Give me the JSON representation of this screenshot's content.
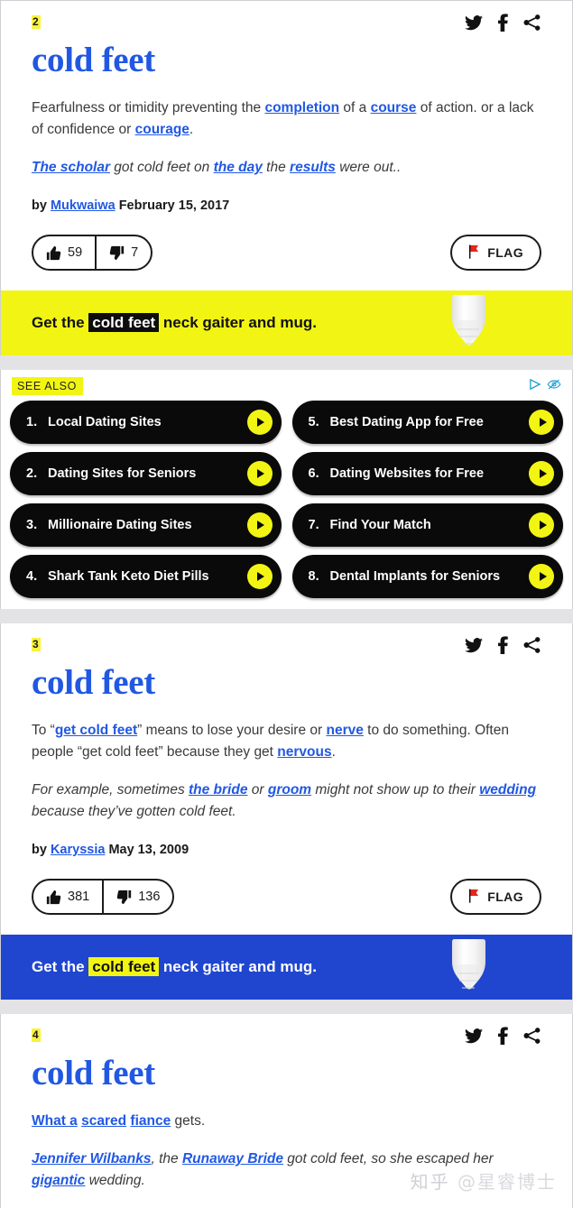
{
  "site": {
    "background_color": "#e3e3e5",
    "card_background": "#ffffff",
    "link_color": "#2158e3",
    "accent_yellow": "#f2f513",
    "accent_blue": "#2046cf"
  },
  "definitions": [
    {
      "number": "2",
      "word": "cold feet",
      "meaning_parts": [
        {
          "text": "Fearfulness or timidity preventing the ",
          "link": false
        },
        {
          "text": "completion",
          "link": true
        },
        {
          "text": " of a ",
          "link": false
        },
        {
          "text": "course",
          "link": true
        },
        {
          "text": " of action. or a lack of confidence or ",
          "link": false
        },
        {
          "text": "courage",
          "link": true
        },
        {
          "text": ".",
          "link": false
        }
      ],
      "example_parts": [
        {
          "text": "The scholar",
          "link": true
        },
        {
          "text": " got cold feet on ",
          "link": false
        },
        {
          "text": "the day",
          "link": true
        },
        {
          "text": " the ",
          "link": false
        },
        {
          "text": "results",
          "link": true
        },
        {
          "text": " were out..",
          "link": false
        }
      ],
      "by_label": "by ",
      "author": "Mukwaiwa",
      "date": " February 15, 2017",
      "upvotes": "59",
      "downvotes": "7",
      "flag_label": "FLAG",
      "merch": {
        "style": "yellow",
        "prefix": "Get the ",
        "highlight": "cold feet",
        "suffix": " neck gaiter and mug."
      }
    },
    {
      "number": "3",
      "word": "cold feet",
      "meaning_parts": [
        {
          "text": "To “",
          "link": false
        },
        {
          "text": "get cold feet",
          "link": true
        },
        {
          "text": "” means to lose your desire or ",
          "link": false
        },
        {
          "text": "nerve",
          "link": true
        },
        {
          "text": " to do something. Often people “get cold feet” because they get ",
          "link": false
        },
        {
          "text": "nervous",
          "link": true
        },
        {
          "text": ".",
          "link": false
        }
      ],
      "example_parts": [
        {
          "text": "For example, sometimes ",
          "link": false
        },
        {
          "text": "the bride",
          "link": true
        },
        {
          "text": " or ",
          "link": false
        },
        {
          "text": "groom",
          "link": true
        },
        {
          "text": " might not show up to their ",
          "link": false
        },
        {
          "text": "wedding",
          "link": true
        },
        {
          "text": " because they’ve gotten cold feet.",
          "link": false
        }
      ],
      "by_label": "by ",
      "author": "Karyssia",
      "date": " May 13, 2009",
      "upvotes": "381",
      "downvotes": "136",
      "flag_label": "FLAG",
      "merch": {
        "style": "blue",
        "prefix": "Get the ",
        "highlight": "cold feet",
        "suffix": " neck gaiter and mug."
      }
    },
    {
      "number": "4",
      "word": "cold feet",
      "meaning_parts": [
        {
          "text": "What a",
          "link": true
        },
        {
          "text": " ",
          "link": false
        },
        {
          "text": "scared",
          "link": true
        },
        {
          "text": " ",
          "link": false
        },
        {
          "text": "fiance",
          "link": true
        },
        {
          "text": " gets.",
          "link": false
        }
      ],
      "example_parts": [
        {
          "text": "Jennifer Wilbanks",
          "link": true
        },
        {
          "text": ", the ",
          "link": false
        },
        {
          "text": "Runaway Bride",
          "link": true
        },
        {
          "text": " got cold feet, so she escaped her ",
          "link": false
        },
        {
          "text": "gigantic",
          "link": true
        },
        {
          "text": " wedding.",
          "link": false
        }
      ]
    }
  ],
  "social_icons": [
    {
      "name": "twitter-icon",
      "label": "Twitter"
    },
    {
      "name": "facebook-icon",
      "label": "Facebook"
    },
    {
      "name": "share-icon",
      "label": "Share"
    }
  ],
  "ad_unit": {
    "see_also_label": "SEE ALSO",
    "adchoices_icons": [
      "adchoices-triangle-icon",
      "hide-ad-eye-icon"
    ],
    "items": [
      {
        "num": "1.",
        "label": "Local Dating Sites"
      },
      {
        "num": "5.",
        "label": "Best Dating App for Free"
      },
      {
        "num": "2.",
        "label": "Dating Sites for Seniors"
      },
      {
        "num": "6.",
        "label": "Dating Websites for Free"
      },
      {
        "num": "3.",
        "label": "Millionaire Dating Sites"
      },
      {
        "num": "7.",
        "label": "Find Your Match"
      },
      {
        "num": "4.",
        "label": "Shark Tank Keto Diet Pills"
      },
      {
        "num": "8.",
        "label": "Dental Implants for Seniors"
      }
    ]
  },
  "watermark": {
    "logo": "知乎",
    "handle": "@星睿博士"
  }
}
